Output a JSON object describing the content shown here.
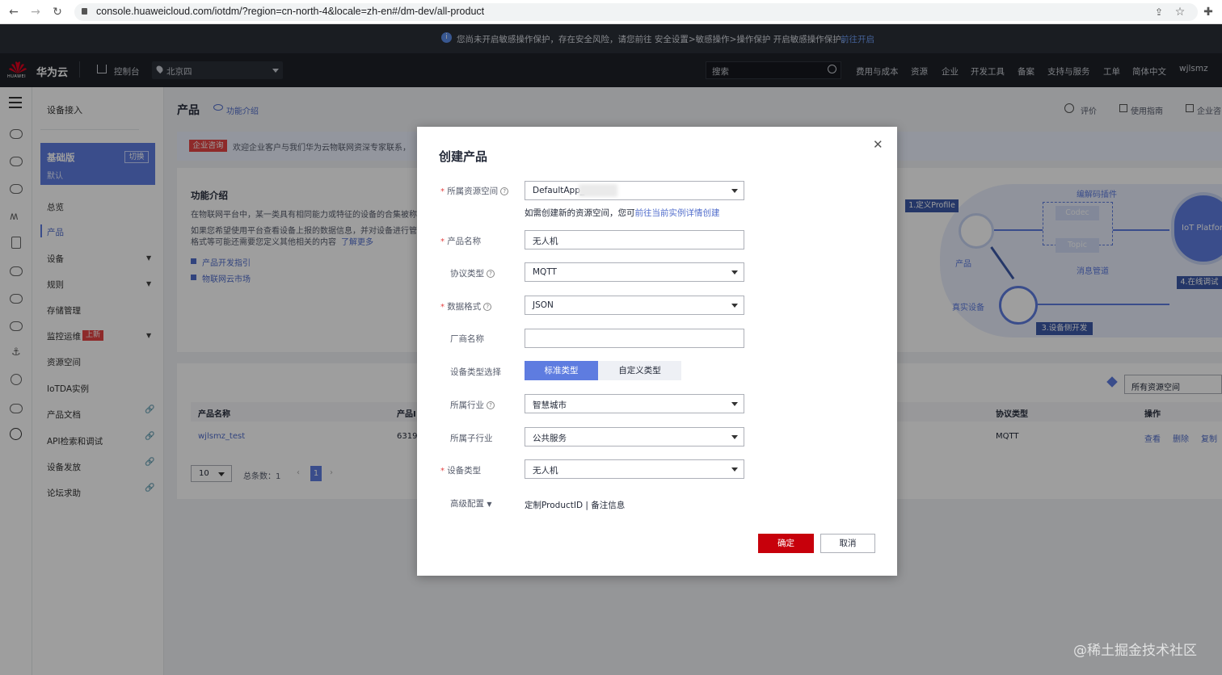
{
  "browser": {
    "url": "console.huaweicloud.com/iotdm/?region=cn-north-4&locale=zh-en#/dm-dev/all-product"
  },
  "notice": {
    "text": "您尚未开启敏感操作保护，存在安全风险，请您前往 安全设置>敏感操作>操作保护 开启敏感操作保护。",
    "link": "前往开启"
  },
  "topnav": {
    "logo_text": "华为云",
    "logo_sub": "HUAWEI",
    "console": "控制台",
    "region": "北京四",
    "search_placeholder": "搜索",
    "items": [
      "费用与成本",
      "资源",
      "企业",
      "开发工具",
      "备案",
      "支持与服务",
      "工单",
      "简体中文",
      "wjlsmz"
    ]
  },
  "sidebar": {
    "section_title": "设备接入",
    "plan_title": "基础版",
    "plan_switch": "切换",
    "plan_sub": "默认",
    "items": [
      "总览",
      "产品",
      "设备",
      "规则",
      "存储管理",
      "监控运维",
      "资源空间",
      "IoTDA实例",
      "产品文档",
      "API检索和调试",
      "设备发放",
      "论坛求助"
    ],
    "new_badge": "上新"
  },
  "main": {
    "page_title": "产品",
    "intro_link": "功能介绍",
    "header_actions": [
      "评价",
      "使用指南",
      "企业咨"
    ],
    "enterprise_tag": "企业咨询",
    "enterprise_text": "欢迎企业客户与我们华为云物联网资深专家联系，",
    "feature_title": "功能介绍",
    "feature_p1": "在物联网平台中，某一类具有相同能力或特征的设备的合集被称",
    "feature_p2": "如果您希望使用平台查看设备上报的数据信息，并对设备进行管",
    "feature_p3": "格式等可能还需要您定义其他相关的内容",
    "learn_more": "了解更多",
    "links": [
      "产品开发指引",
      "物联网云市场"
    ],
    "diagram": {
      "step1": "1.定义Profile",
      "codec_plugin": "编解码插件",
      "codec": "Codec",
      "topic": "Topic",
      "msg_mgmt": "消息管道",
      "product": "产品",
      "real_device": "真实设备",
      "step3": "3.设备侧开发",
      "step4": "4.在线调试",
      "platform": "IoT Platfor"
    },
    "resource_select": "所有资源空间",
    "table": {
      "headers": [
        "产品名称",
        "产品I",
        "协议类型",
        "操作"
      ],
      "row": {
        "name": "wjlsmz_test",
        "id": "6319",
        "protocol": "MQTT",
        "actions": [
          "查看",
          "删除",
          "复制"
        ]
      }
    },
    "pager": {
      "size": "10",
      "total": "总条数：1",
      "page": "1"
    }
  },
  "dialog": {
    "title": "创建产品",
    "fields": {
      "resource_space": {
        "label": "所属资源空间",
        "value": "DefaultApp_"
      },
      "hint": "如需创建新的资源空间，您可",
      "hint_link": "前往当前实例详情创建",
      "product_name": {
        "label": "产品名称",
        "value": "无人机"
      },
      "protocol": {
        "label": "协议类型",
        "value": "MQTT"
      },
      "data_format": {
        "label": "数据格式",
        "value": "JSON"
      },
      "vendor": {
        "label": "厂商名称",
        "value": ""
      },
      "device_type_select": {
        "label": "设备类型选择",
        "options": [
          "标准类型",
          "自定义类型"
        ]
      },
      "industry": {
        "label": "所属行业",
        "value": "智慧城市"
      },
      "sub_industry": {
        "label": "所属子行业",
        "value": "公共服务"
      },
      "device_type": {
        "label": "设备类型",
        "value": "无人机"
      },
      "advanced": {
        "label": "高级配置",
        "value": "定制ProductID | 备注信息"
      }
    },
    "ok": "确定",
    "cancel": "取消"
  },
  "watermark": "@稀土掘金技术社区"
}
